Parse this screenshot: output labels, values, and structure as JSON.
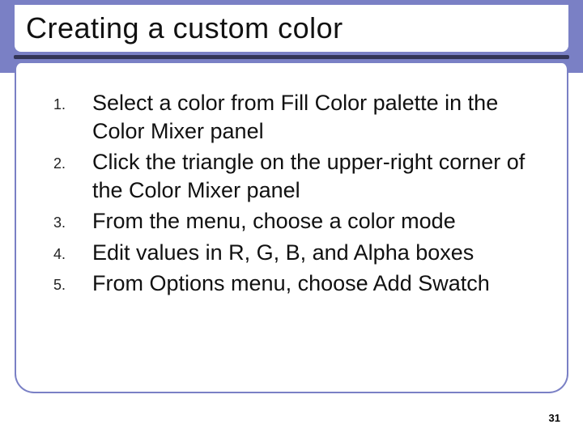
{
  "title": "Creating a custom color",
  "steps": [
    "Select a color from Fill Color palette in the Color Mixer panel",
    "Click the triangle on the upper-right corner of the Color Mixer panel",
    "From the menu, choose a color mode",
    "Edit values in R, G, B, and Alpha boxes",
    "From Options menu, choose Add Swatch"
  ],
  "page_number": "31"
}
